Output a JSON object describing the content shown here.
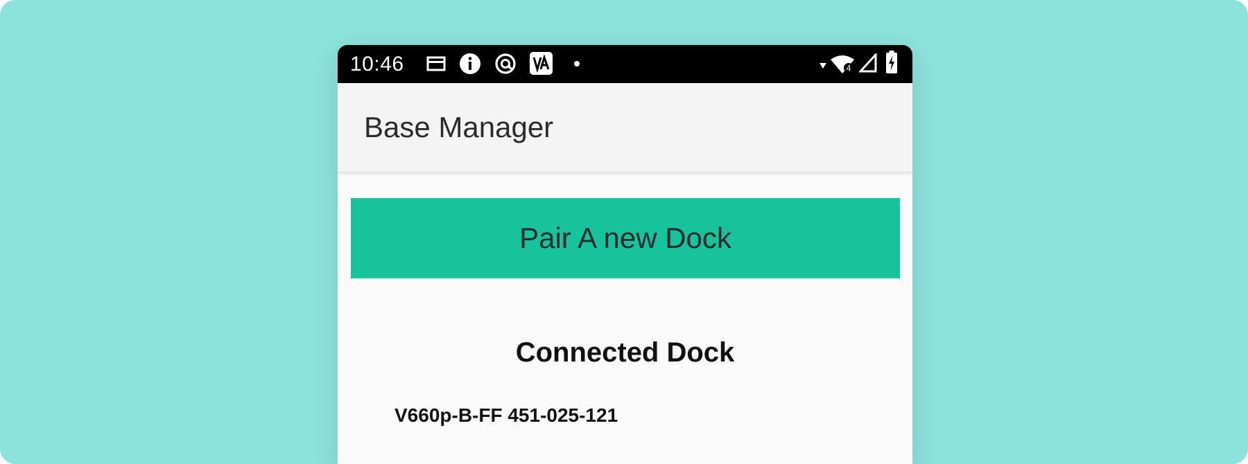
{
  "colors": {
    "page_background": "#8ce2dc",
    "status_bar": "#000000",
    "app_bar": "#f4f4f4",
    "content_background": "#fafafa",
    "accent_button": "#17c39c",
    "text_dark": "#2b2b2b"
  },
  "status_bar": {
    "time": "10:46",
    "left_icons": [
      "card-icon",
      "info-icon",
      "at-sign-icon",
      "app-badge-icon",
      "notification-dot-icon"
    ],
    "right_icons": [
      "wifi-signal-icon",
      "cell-signal-icon",
      "battery-charging-icon"
    ],
    "network_badge": "4"
  },
  "app_bar": {
    "title": "Base Manager"
  },
  "main": {
    "pair_button_label": "Pair A new Dock",
    "connected_section_title": "Connected Dock",
    "docks": [
      {
        "label": "V660p-B-FF 451-025-121"
      }
    ]
  }
}
